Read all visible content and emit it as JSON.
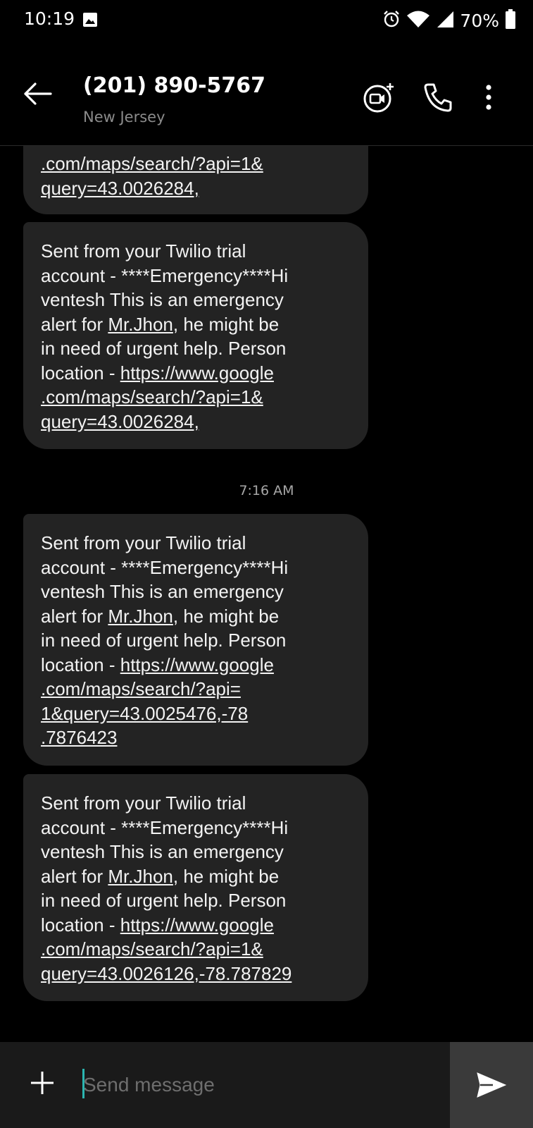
{
  "status_bar": {
    "time": "10:19",
    "battery": "70%"
  },
  "header": {
    "name": "(201) 890-5767",
    "location": "New Jersey"
  },
  "messages": [
    {
      "parts": [
        {
          "text": ".com/maps/search/?api=1&\nquery=43.0026284,",
          "link": true
        }
      ]
    },
    {
      "parts": [
        {
          "text": "Sent from your Twilio trial\naccount - ****Emergency****Hi\nventesh This is an emergency\nalert for ",
          "link": false
        },
        {
          "text": "Mr.Jhon",
          "link": true
        },
        {
          "text": ", he might be\nin need of urgent help. Person\nlocation - ",
          "link": false
        },
        {
          "text": "https://www.google\n.com/maps/search/?api=1&\nquery=43.0026284,",
          "link": true
        }
      ]
    },
    {
      "parts": [
        {
          "text": "Sent from your Twilio trial\naccount - ****Emergency****Hi\nventesh This is an emergency\nalert for ",
          "link": false
        },
        {
          "text": "Mr.Jhon",
          "link": true
        },
        {
          "text": ", he might be\nin need of urgent help. Person\nlocation - ",
          "link": false
        },
        {
          "text": "https://www.google\n.com/maps/search/?api=\n1&query=43.0025476,-78\n.7876423",
          "link": true
        }
      ]
    },
    {
      "parts": [
        {
          "text": "Sent from your Twilio trial\naccount - ****Emergency****Hi\nventesh This is an emergency\nalert for ",
          "link": false
        },
        {
          "text": "Mr.Jhon",
          "link": true
        },
        {
          "text": ", he might be\nin need of urgent help. Person\nlocation - ",
          "link": false
        },
        {
          "text": "https://www.google\n.com/maps/search/?api=1&\nquery=43.0026126,-78.787829",
          "link": true
        }
      ]
    }
  ],
  "timestamp": "7:16 AM",
  "compose": {
    "placeholder": "Send message"
  },
  "colors": {
    "background": "#000000",
    "bubble": "#232323",
    "accent": "#2bb5b0"
  }
}
